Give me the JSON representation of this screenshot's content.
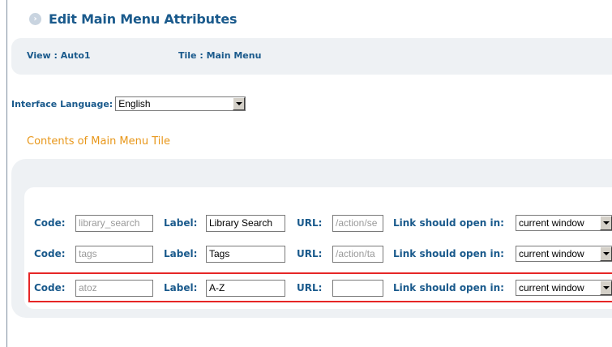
{
  "header": {
    "title": "Edit Main Menu Attributes",
    "icon": "chevron-right-icon"
  },
  "info": {
    "view": "View : Auto1",
    "tile": "Tile : Main Menu"
  },
  "language": {
    "label": "Interface Language:",
    "selected": "English"
  },
  "section": {
    "title": "Contents of Main Menu Tile"
  },
  "labels": {
    "code": "Code:",
    "label": "Label:",
    "url": "URL:",
    "open_in": "Link should open in:"
  },
  "rows": [
    {
      "code": "library_search",
      "label": "Library Search",
      "url": "/action/se",
      "open_in": "current window"
    },
    {
      "code": "tags",
      "label": "Tags",
      "url": "/action/ta",
      "open_in": "current window"
    },
    {
      "code": "atoz",
      "label": "A-Z",
      "url": "",
      "open_in": "current window"
    }
  ],
  "colors": {
    "accent": "#1a5a8c",
    "section_title": "#e8971a",
    "highlight": "#e62626",
    "panel": "#eef1f4"
  }
}
